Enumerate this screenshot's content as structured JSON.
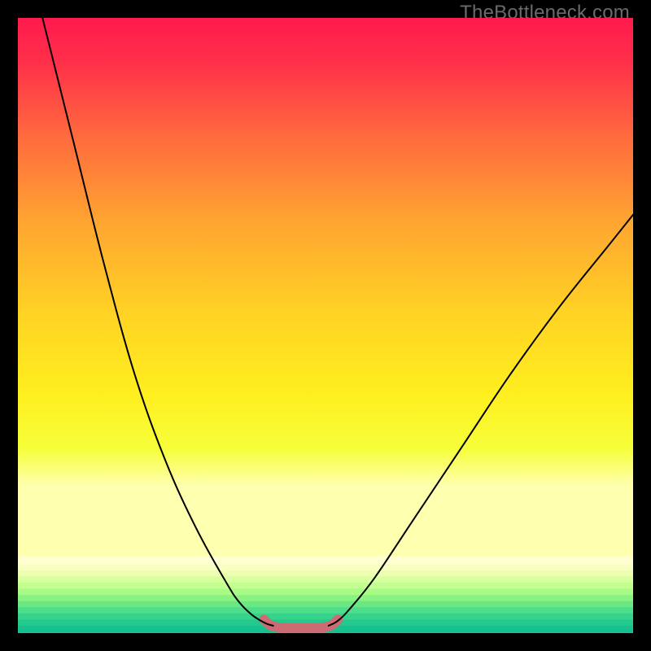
{
  "watermark": "TheBottleneck.com",
  "chart_data": {
    "type": "line",
    "title": "",
    "xlabel": "",
    "ylabel": "",
    "xlim": [
      0,
      100
    ],
    "ylim": [
      0,
      100
    ],
    "grid": false,
    "legend": false,
    "series": [
      {
        "name": "left-curve",
        "x": [
          4,
          9,
          14,
          19,
          24,
          29,
          34,
          36,
          38,
          39.5,
          40.5,
          41.5
        ],
        "values": [
          100,
          80,
          60,
          42,
          28,
          17,
          8,
          5,
          3,
          2,
          1.5,
          1.2
        ],
        "stroke": "#000000",
        "width": 2
      },
      {
        "name": "right-curve",
        "x": [
          50.5,
          52,
          54,
          58,
          64,
          72,
          80,
          88,
          96,
          100
        ],
        "values": [
          1.2,
          2,
          4,
          9,
          18,
          30,
          42,
          53,
          63,
          68
        ],
        "stroke": "#000000",
        "width": 2
      },
      {
        "name": "bottom-highlight",
        "x": [
          40,
          41,
          42.5,
          44,
          46,
          48,
          49.5,
          51,
          52
        ],
        "values": [
          2.2,
          1.3,
          0.9,
          0.8,
          0.8,
          0.8,
          0.9,
          1.3,
          2.2
        ],
        "stroke": "#cc6b72",
        "width": 12
      }
    ],
    "background_gradient": {
      "stops": [
        {
          "offset": 0.0,
          "color": "#ff1a4d"
        },
        {
          "offset": 0.08,
          "color": "#ff2f4a"
        },
        {
          "offset": 0.22,
          "color": "#ff6a3e"
        },
        {
          "offset": 0.38,
          "color": "#ffa531"
        },
        {
          "offset": 0.55,
          "color": "#ffd324"
        },
        {
          "offset": 0.7,
          "color": "#ffef1f"
        },
        {
          "offset": 0.8,
          "color": "#f6ff3a"
        },
        {
          "offset": 0.87,
          "color": "#ffffb0"
        }
      ]
    },
    "bottom_bands": [
      {
        "y": 0.875,
        "h": 0.013,
        "color": "#ffffd2"
      },
      {
        "y": 0.888,
        "h": 0.01,
        "color": "#f8ffc0"
      },
      {
        "y": 0.898,
        "h": 0.01,
        "color": "#ecffb0"
      },
      {
        "y": 0.908,
        "h": 0.01,
        "color": "#d9ff9e"
      },
      {
        "y": 0.918,
        "h": 0.01,
        "color": "#c3ff90"
      },
      {
        "y": 0.928,
        "h": 0.01,
        "color": "#a8fb86"
      },
      {
        "y": 0.938,
        "h": 0.01,
        "color": "#8af281"
      },
      {
        "y": 0.948,
        "h": 0.01,
        "color": "#6be784"
      },
      {
        "y": 0.958,
        "h": 0.01,
        "color": "#4edd89"
      },
      {
        "y": 0.968,
        "h": 0.01,
        "color": "#36d38d"
      },
      {
        "y": 0.978,
        "h": 0.01,
        "color": "#23c98f"
      },
      {
        "y": 0.988,
        "h": 0.012,
        "color": "#18c090"
      }
    ]
  }
}
